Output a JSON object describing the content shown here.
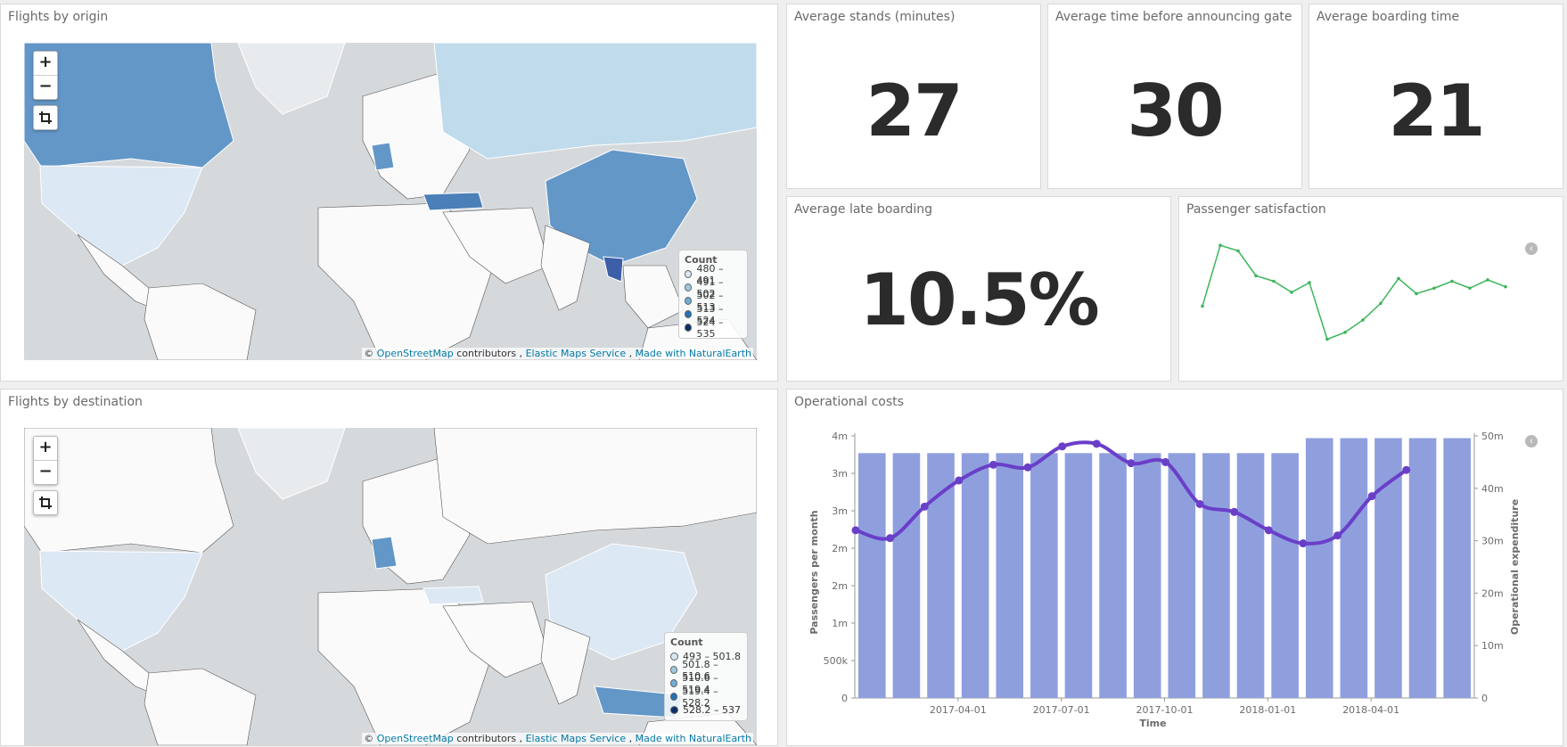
{
  "origin_panel": {
    "title": "Flights by origin",
    "legend": {
      "title": "Count",
      "items": [
        {
          "label": "480 – 491",
          "color": "#d6e6f5"
        },
        {
          "label": "491 – 502",
          "color": "#9ecae1"
        },
        {
          "label": "502 – 513",
          "color": "#6baed6"
        },
        {
          "label": "513 – 524",
          "color": "#2171b5"
        },
        {
          "label": "524 – 535",
          "color": "#08306b"
        }
      ]
    }
  },
  "destination_panel": {
    "title": "Flights by destination",
    "legend": {
      "title": "Count",
      "items": [
        {
          "label": "493 – 501.8",
          "color": "#d6e6f5"
        },
        {
          "label": "501.8 – 510.6",
          "color": "#9ecae1"
        },
        {
          "label": "510.6 – 519.4",
          "color": "#6baed6"
        },
        {
          "label": "519.4 – 528.2",
          "color": "#2171b5"
        },
        {
          "label": "528.2 – 537",
          "color": "#08306b"
        }
      ]
    }
  },
  "map_controls": {
    "zoom_in": "+",
    "zoom_out": "−"
  },
  "attribution": {
    "prefix": "© ",
    "osm": "OpenStreetMap",
    "contributors": " contributors , ",
    "ems": "Elastic Maps Service",
    "sep": " , ",
    "ne": "Made with NaturalEarth"
  },
  "metrics": {
    "stands": {
      "title": "Average stands (minutes)",
      "value": "27"
    },
    "gate": {
      "title": "Average time before announcing gate",
      "value": "30"
    },
    "boarding": {
      "title": "Average boarding time",
      "value": "21"
    },
    "late": {
      "title": "Average late boarding",
      "value": "10.5%"
    }
  },
  "satisfaction_panel": {
    "title": "Passenger satisfaction"
  },
  "costs_panel": {
    "title": "Operational costs"
  },
  "colors": {
    "bar": "#8f9fde",
    "line": "#6a3fc8",
    "spark": "#3cb55a",
    "map_fill": "#6397c8"
  },
  "chart_data": [
    {
      "type": "line",
      "title": "Passenger satisfaction",
      "values": [
        3.2,
        7.6,
        7.2,
        5.4,
        5.0,
        4.2,
        4.9,
        0.8,
        1.3,
        2.2,
        3.4,
        5.2,
        4.1,
        4.5,
        5.0,
        4.5,
        5.1,
        4.6
      ]
    },
    {
      "type": "bar",
      "title": "Operational costs",
      "xlabel": "Time",
      "ylabel": "Passengers per month",
      "y2label": "Operational expenditure",
      "ylim": [
        0,
        3500000
      ],
      "y2lim": [
        0,
        50000000
      ],
      "yticks": [
        "0",
        "500k",
        "1m",
        "2m",
        "2m",
        "3m",
        "3m",
        "4m"
      ],
      "y2ticks": [
        "0",
        "10m",
        "20m",
        "30m",
        "40m",
        "50m"
      ],
      "xticks": [
        "2017-04-01",
        "2017-07-01",
        "2017-10-01",
        "2018-01-01",
        "2018-04-01"
      ],
      "xtick_index": [
        3,
        6,
        9,
        12,
        15
      ],
      "series": [
        {
          "name": "Passengers per month",
          "type": "bar",
          "values": [
            3270000,
            3270000,
            3270000,
            3270000,
            3270000,
            3270000,
            3270000,
            3270000,
            3270000,
            3270000,
            3270000,
            3270000,
            3270000,
            3470000,
            3470000,
            3470000,
            3470000,
            3470000
          ]
        },
        {
          "name": "Operational expenditure",
          "type": "line",
          "values": [
            32000000,
            30500000,
            36500000,
            41500000,
            44500000,
            44000000,
            48000000,
            48500000,
            44800000,
            45000000,
            37000000,
            35500000,
            32000000,
            29500000,
            31000000,
            38500000,
            43500000
          ]
        }
      ]
    }
  ]
}
